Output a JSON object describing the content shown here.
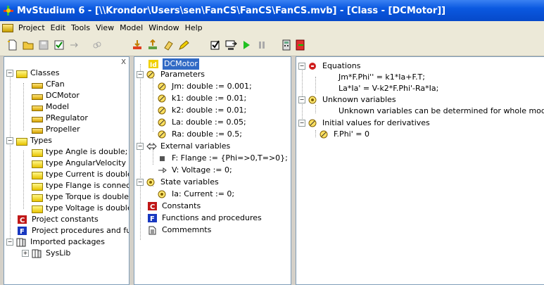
{
  "window": {
    "title": "MvStudium 6 - [\\\\Krondor\\Users\\sen\\FanCS\\FanCS\\FanCS.mvb] - [Class - [DCMotor]]"
  },
  "menu": [
    "Project",
    "Edit",
    "Tools",
    "View",
    "Model",
    "Window",
    "Help"
  ],
  "left_tree": {
    "close_glyph": "X",
    "classes_label": "Classes",
    "classes": [
      "CFan",
      "DCMotor",
      "Model",
      "PRegulator",
      "Propeller"
    ],
    "types_label": "Types",
    "types": [
      "type Angle is double; --",
      "type AngularVelocity is",
      "type Current is double;",
      "type Flange is connecto",
      "type Torque is double; -",
      "type Voltage is double;"
    ],
    "project_constants": "Project constants",
    "project_procedures": "Project procedures and fun",
    "imported_label": "Imported packages",
    "imported": [
      "SysLib"
    ]
  },
  "middle_tree": {
    "root": "DCMotor",
    "parameters_label": "Parameters",
    "parameters": [
      "Jm: double := 0.001;",
      "k1: double := 0.01;",
      "k2: double := 0.01;",
      "La: double := 0.05;",
      "Ra: double := 0.5;"
    ],
    "external_label": "External variables",
    "external": [
      "F: Flange := {Phi=>0,T=>0};",
      "V: Voltage := 0;"
    ],
    "state_label": "State variables",
    "state": [
      "Ia: Current := 0;"
    ],
    "constants": "Constants",
    "functions": "Functions and procedures",
    "comments": "Commemnts"
  },
  "right_tree": {
    "equations_label": "Equations",
    "equations": [
      "Jm*F.Phi'' = k1*Ia+F.T;",
      "La*Ia' = V-k2*F.Phi'-Ra*Ia;"
    ],
    "unknown_label": "Unknown variables",
    "unknown_text": "Unknown variables can be determined for whole model only",
    "initial_label": "Initial values for derivatives",
    "initial": [
      "F.Phi' = 0"
    ]
  }
}
